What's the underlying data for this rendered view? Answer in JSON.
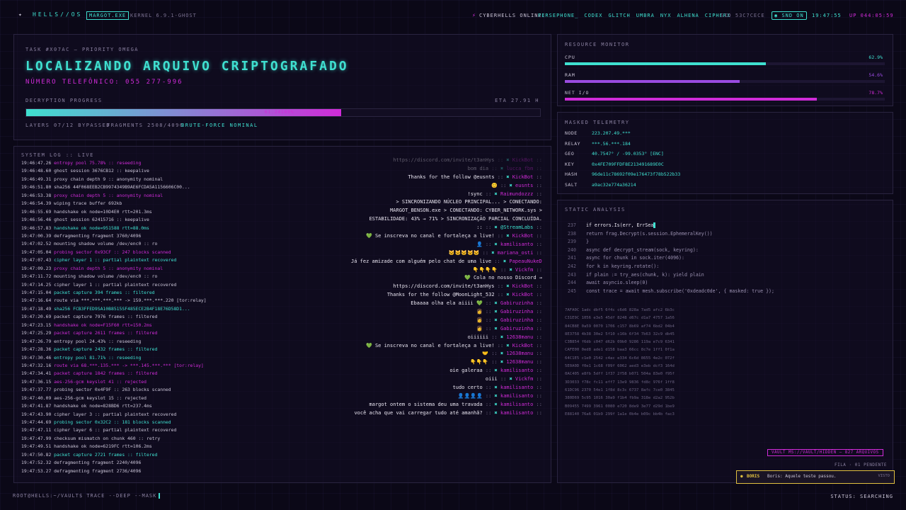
{
  "topbar": {
    "logo": "HELLS//OS",
    "user_chip": "MARGOT.EXE",
    "kernel": "KERNEL 6.9.1-GHOST",
    "online_label": "CYBERHELLS ONLINE:",
    "online_users": [
      "PERSEPHONE_",
      "CODEX",
      "GLITCH",
      "UMBRA",
      "NYX",
      "ALHENA",
      "CIPHERX"
    ],
    "sid": "SID 53C7CECE",
    "snd": "SND ON",
    "clock": "19:47:55",
    "uptime": "UP 044:05:59"
  },
  "task": {
    "subtitle": "TASK #X07AC — PRIORITY OMEGA",
    "title": "LOCALIZANDO ARQUIVO CRIPTOGRAFADO",
    "phone": "NÚMERO TELEFÔNICO: 055 277-996",
    "progress_label": "DECRYPTION PROGRESS",
    "eta": "ETA 27.91 H",
    "progress_text": "61.24189%",
    "progress": 0.6124,
    "layers": "LAYERS 07/12 BYPASSED",
    "fragments": "FRAGMENTS 2508/4096",
    "bruteforce": "BRUTE-FORCE NOMINAL"
  },
  "syslog": {
    "title": "SYSTEM LOG :: LIVE",
    "lines": [
      {
        "t": "19:46:47.26",
        "m": "entropy pool 75.78% :: reseeding",
        "c": "mag"
      },
      {
        "t": "19:46:48.60",
        "m": "ghost session 3676CB12 :: keepalive",
        "c": "w"
      },
      {
        "t": "19:46:49.31",
        "m": "proxy chain depth 9 :: anonymity nominal",
        "c": "w"
      },
      {
        "t": "19:46:51.80",
        "m": "sha256 44F068EEB2CB9974349B9AE6FCDA5A1156606C00...",
        "c": "w"
      },
      {
        "t": "19:46:53.38",
        "m": "proxy chain depth 5 :: anonymity nominal",
        "c": "mag"
      },
      {
        "t": "19:46:54.39",
        "m": "wiping trace buffer 692kb",
        "c": "w"
      },
      {
        "t": "19:46:55.69",
        "m": "handshake ok node=10D4E0 rtt=201.3ms",
        "c": "w"
      },
      {
        "t": "19:46:56.46",
        "m": "ghost session 62415716 :: keepalive",
        "c": "w"
      },
      {
        "t": "19:46:57.83",
        "m": "handshake ok node=951588 rtt=88.0ms",
        "c": "cyan"
      },
      {
        "t": "19:47:00.39",
        "m": "defragmenting fragment 3760/4096",
        "c": "w"
      },
      {
        "t": "19:47:02.52",
        "m": "mounting shadow volume /dev/enc0 :: ro",
        "c": "w"
      },
      {
        "t": "19:47:05.04",
        "m": "probing sector 0x93CF :: 247 blocks scanned",
        "c": "mag"
      },
      {
        "t": "19:47:07.43",
        "m": "cipher layer 1 :: partial plaintext recovered",
        "c": "cyan"
      },
      {
        "t": "19:47:09.23",
        "m": "proxy chain depth 5 :: anonymity nominal",
        "c": "mag"
      },
      {
        "t": "19:47:11.72",
        "m": "mounting shadow volume /dev/enc0 :: ro",
        "c": "w"
      },
      {
        "t": "19:47:14.25",
        "m": "cipher layer 1 :: partial plaintext recovered",
        "c": "w"
      },
      {
        "t": "19:47:15.04",
        "m": "packet capture 394 frames :: filtered",
        "c": "cyan"
      },
      {
        "t": "19:47:16.64",
        "m": "route via ***.***.***.*** -> 159.***.***.220 [tor:relay]",
        "c": "w"
      },
      {
        "t": "19:47:18.49",
        "m": "sha256 FCB3FFED9SA10B8515SF485ECE2B4F18E76D58D1...",
        "c": "cyan"
      },
      {
        "t": "19:47:20.69",
        "m": "packet capture 7976 frames :: filtered",
        "c": "w"
      },
      {
        "t": "19:47:23.15",
        "m": "handshake ok node=F15F60 rtt=150.2ms",
        "c": "mag"
      },
      {
        "t": "19:47:25.29",
        "m": "packet capture 2611 frames :: filtered",
        "c": "mag"
      },
      {
        "t": "19:47:26.79",
        "m": "entropy pool 24.43% :: reseeding",
        "c": "w"
      },
      {
        "t": "19:47:28.36",
        "m": "packet capture 2432 frames :: filtered",
        "c": "cyan"
      },
      {
        "t": "19:47:30.46",
        "m": "entropy pool 81.71% :: reseeding",
        "c": "cyan"
      },
      {
        "t": "19:47:32.16",
        "m": "route via 68.***.135.*** -> ***.145.***.*** [tor:relay]",
        "c": "mag"
      },
      {
        "t": "19:47:34.41",
        "m": "packet capture 1842 frames :: filtered",
        "c": "mag"
      },
      {
        "t": "19:47:36.15",
        "m": "aes-256-gcm keyslot 41 :: rejected",
        "c": "mag"
      },
      {
        "t": "19:47:37.77",
        "m": "probing sector 0x4F9F :: 263 blocks scanned",
        "c": "w"
      },
      {
        "t": "19:47:40.09",
        "m": "aes-256-gcm keyslot 15 :: rejected",
        "c": "w"
      },
      {
        "t": "19:47:41.87",
        "m": "handshake ok node=828BD6 rtt=237.4ms",
        "c": "w"
      },
      {
        "t": "19:47:43.90",
        "m": "cipher layer 3 :: partial plaintext recovered",
        "c": "w"
      },
      {
        "t": "19:47:44.69",
        "m": "probing sector 0x32C2 :: 181 blocks scanned",
        "c": "cyan"
      },
      {
        "t": "19:47:47.11",
        "m": "cipher layer 6 :: partial plaintext recovered",
        "c": "w"
      },
      {
        "t": "19:47:47.99",
        "m": "checksum mismatch on chunk 460 :: retry",
        "c": "w"
      },
      {
        "t": "19:47:49.51",
        "m": "handshake ok node=6219FC rtt=106.2ms",
        "c": "w"
      },
      {
        "t": "19:47:50.82",
        "m": "packet capture 2721 frames :: filtered",
        "c": "cyan"
      },
      {
        "t": "19:47:52.32",
        "m": "defragmenting fragment 2240/4096",
        "c": "w"
      },
      {
        "t": "19:47:53.27",
        "m": "defragmenting fragment 2736/4096",
        "c": "w"
      }
    ]
  },
  "chat": {
    "lines": [
      {
        "m": "https://discord.com/invite/t3anHys",
        "u": "KickBot",
        "dim": true
      },
      {
        "m": "bom dia",
        "u": "lucca_fbm",
        "dim": true
      },
      {
        "m": "Thanks for the follow @eusnts",
        "u": "KickBot",
        "dim": false
      },
      {
        "m": "😊",
        "u": "eusnts",
        "dim": false
      },
      {
        "m": "!sync",
        "u": "Raimundozzz",
        "dim": false
      },
      {
        "m": "> SINCRONIZANDO NÚCLEO PRINCIPAL... > CONECTANDO:",
        "u": "",
        "dim": false
      },
      {
        "m": "MARGOT_BENSON.exe > CONECTANDO: CYBER_NETWORK.sys >",
        "u": "",
        "dim": false
      },
      {
        "m": "ESTABILIDADE: 43% → 71% > SINCRONIZAÇÃO PARCIAL CONCLUÍDA.",
        "u": "",
        "dim": false
      },
      {
        "m": "::",
        "u": "@StreamLabs",
        "dim": false,
        "c": "cyan"
      },
      {
        "m": "💚 Se inscreva no canal e fortaleça a live!",
        "u": "KickBot",
        "dim": false
      },
      {
        "m": "👤",
        "u": "kamilisanto",
        "dim": false
      },
      {
        "m": "🐱🐱🐱🐱🐱",
        "u": "mariana_osti",
        "dim": false
      },
      {
        "m": "Já fez amizade com alguém pelo chat de uma live",
        "u": "PapeauNukeDoe",
        "dim": false
      },
      {
        "m": "👇👇👇👇",
        "u": "Vickfm",
        "dim": false
      },
      {
        "m": "💚 Cola no nosso Discord →",
        "u": "",
        "dim": false
      },
      {
        "m": "https://discord.com/invite/t3anHys",
        "u": "KickBot",
        "dim": false
      },
      {
        "m": "Thanks for the follow @MoonLight_532",
        "u": "KickBot",
        "dim": false
      },
      {
        "m": "Ebaaaa olha ela aiiii 💚",
        "u": "Gabiruzinha",
        "dim": false
      },
      {
        "m": "👩",
        "u": "Gabiruzinha",
        "dim": false
      },
      {
        "m": "👩",
        "u": "Gabiruzinha",
        "dim": false
      },
      {
        "m": "👩",
        "u": "Gabiruzinha",
        "dim": false
      },
      {
        "m": "oiiiiii",
        "u": "12638manu",
        "dim": false
      },
      {
        "m": "💚 Se inscreva no canal e fortaleça a live!",
        "u": "KickBot",
        "dim": false
      },
      {
        "m": "🤝",
        "u": "12638manu",
        "dim": false
      },
      {
        "m": "👇👇👇",
        "u": "12638manu",
        "dim": false
      },
      {
        "m": "oie galeraa",
        "u": "kamilisanto",
        "dim": false
      },
      {
        "m": "oiii",
        "u": "Vickfm",
        "dim": false
      },
      {
        "m": "tudo certo",
        "u": "kamilisanto",
        "dim": false
      },
      {
        "m": "👤👤👤👤",
        "u": "kamilisanto",
        "dim": false
      },
      {
        "m": "margot ontem o sistema deu uma travada",
        "u": "kamilisanto",
        "dim": false
      },
      {
        "m": "você acha que vai carregar tudo até amanhã?",
        "u": "kamilisanto",
        "dim": false
      }
    ]
  },
  "resources": {
    "title": "RESOURCE MONITOR",
    "items": [
      {
        "label": "CPU",
        "value": "62.9%",
        "pct": 62.9,
        "color": "#3fe0d0"
      },
      {
        "label": "RAM",
        "value": "54.6%",
        "pct": 54.6,
        "color": "#9a4be0"
      },
      {
        "label": "NET I/O",
        "value": "78.7%",
        "pct": 78.7,
        "color": "#d02bd8"
      }
    ]
  },
  "telemetry": {
    "title": "MASKED TELEMETRY",
    "rows": [
      {
        "k": "NODE",
        "v": "223.207.49.***"
      },
      {
        "k": "RELAY",
        "v": "***.56.***.184"
      },
      {
        "k": "GEO",
        "v": "40.7547° / -99.0353° [ENC]"
      },
      {
        "k": "KEY",
        "v": "0x4FE709FFDF8E213491689E0C"
      },
      {
        "k": "HASH",
        "v": "96de11c78692f09e176473f78b522b33"
      },
      {
        "k": "SALT",
        "v": "a9ac32e774a36214"
      }
    ]
  },
  "static": {
    "title": "STATIC ANALYSIS",
    "code": [
      {
        "n": "237",
        "c": "if errors.Is(err, ErrSea"
      },
      {
        "n": "238",
        "c": "return frag.Decrypt(s.session.EphemeralKey())"
      },
      {
        "n": "239",
        "c": "}"
      },
      {
        "n": "240",
        "c": "async def decrypt_stream(sock, keyring):"
      },
      {
        "n": "241",
        "c": "async for chunk in sock.iter(4096):"
      },
      {
        "n": "242",
        "c": "for k in keyring.rotate():"
      },
      {
        "n": "243",
        "c": "if plain := try_aes(chunk, k): yield plain"
      },
      {
        "n": "244",
        "c": "await asyncio.sleep(0)"
      },
      {
        "n": "245",
        "c": "const trace = await mesh.subscribe('0xdeadc0de', { masked: true });"
      }
    ],
    "hex": [
      "7AFA0C 1adc dbf5 6f4c c6d6 828a 7ad5 afc2 6b3c",
      "C31E9C 1056 e3e5 45df 8248 d67c d1a7 4757 1a56",
      "84CB8E 0a59 0070 1706 c157 8b69 af74 6bd2 04b4",
      "8E3758 4b38 30e2 5f10 c16b 6f34 7b63 32c9 db45",
      "C3B854 f6db c047 d62b 09b0 9286 119a e7c9 6341",
      "CAFE00 0ed8 ade1 d158 baa3 66cc 8c7e 1ff1 0f1a",
      "64C1E5 c1e0 2542 c4ac e334 6c6d 8655 4e2c 072f",
      "5E0A0D f0e1 1c68 f09f 6062 aed3 e3eb dcf3 164d",
      "0AC405 e8fb 5dff 1f37 2f58 b071 504a 83e0 f95f",
      "3D3033 f78c fc11 eff7 13e9 9836 fd8c 976f 1ff8",
      "61DC96 2370 54e1 1f8d 8c3c 6737 8afc 7ce0 3845",
      "380D69 5c95 1016 30a9 f1b4 fb9a 318e d2a2 952b",
      "B09455 7499 3961 0080 e720 8de9 3e77 d29d 1be9",
      "E88140 76a6 01b9 299f 1a1e 0b4e b09c bb4b fac3"
    ]
  },
  "vault": "VAULT MS://VAULT/HIDDEN — 827 ARQUIVOS",
  "queue": "FILA · 01 PENDENTE",
  "toast": {
    "name": "BORIS",
    "msg": "Boris: Aquele teste passou.",
    "seen": "VISTO"
  },
  "bottom": {
    "prompt": "ROOT@HELLS:~/VAULT$ TRACE --DEEP --MASK",
    "status": "STATUS: SEARCHING"
  }
}
